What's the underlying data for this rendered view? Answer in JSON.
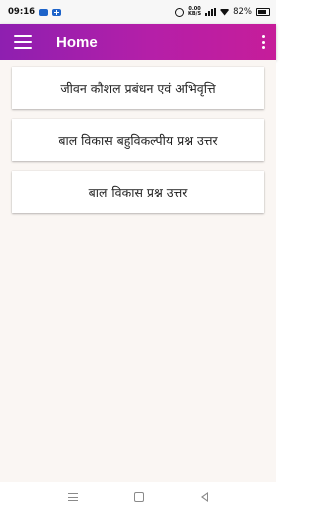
{
  "status_bar": {
    "time": "09:16",
    "speed_value": "0.00",
    "speed_unit": "KB/S",
    "battery_percent": "82%",
    "icons": [
      "cloud-icon",
      "plus-icon",
      "alarm-icon",
      "signal-icon",
      "wifi-icon",
      "battery-icon"
    ]
  },
  "app_bar": {
    "title": "Home",
    "menu_icon": "hamburger-menu-icon",
    "overflow_icon": "more-vertical-icon",
    "gradient_start": "#8e1fb0",
    "gradient_end": "#c61d9a"
  },
  "content": {
    "background": "#faf6f3",
    "items": [
      {
        "label": "जीवन कौशल प्रबंधन एवं अभिवृत्ति"
      },
      {
        "label": "बाल विकास बहुविकल्पीय प्रश्न उत्तर"
      },
      {
        "label": "बाल विकास प्रश्न उत्तर"
      }
    ]
  },
  "nav_bar": {
    "icons": [
      "recents-icon",
      "home-icon",
      "back-icon"
    ]
  }
}
